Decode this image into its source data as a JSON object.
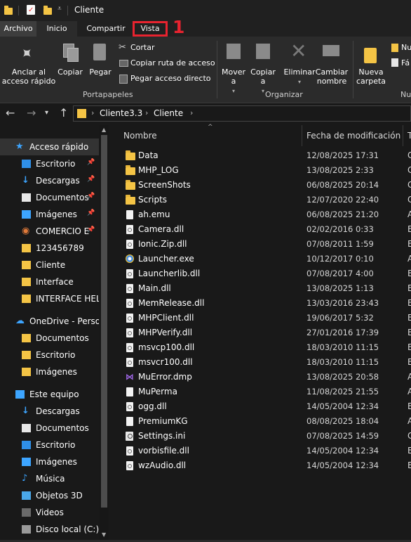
{
  "window": {
    "title": "Cliente"
  },
  "tabs": {
    "file": "Archivo",
    "home": "Inicio",
    "share": "Compartir",
    "view": "Vista"
  },
  "annotation": {
    "step_number": "1",
    "highlight_color": "#e8232f"
  },
  "ribbon": {
    "pin_label": "Anclar al acceso rápido",
    "copy_label": "Copiar",
    "paste_label": "Pegar",
    "cut_label": "Cortar",
    "copy_path_label": "Copiar ruta de acceso",
    "paste_shortcut_label": "Pegar acceso directo",
    "clipboard_group": "Portapapeles",
    "move_to_label": "Mover a",
    "copy_to_label": "Copiar a",
    "delete_label": "Eliminar",
    "rename_label": "Cambiar nombre",
    "organize_group": "Organizar",
    "new_folder_label": "Nueva carpeta",
    "new_item_label": "Nu",
    "easy_access_label": "Fá",
    "new_group": "Nu"
  },
  "address": {
    "crumb1": "Cliente3.3",
    "crumb2": "Cliente"
  },
  "columns": {
    "name": "Nombre",
    "date": "Fecha de modificación",
    "type": "T"
  },
  "sidebar": {
    "items": [
      {
        "label": "Acceso rápido",
        "icon": "star-icon",
        "pinned": false
      },
      {
        "label": "Escritorio",
        "icon": "desktop-icon",
        "pinned": true
      },
      {
        "label": "Descargas",
        "icon": "download-icon",
        "pinned": true
      },
      {
        "label": "Documentos",
        "icon": "document-icon",
        "pinned": true
      },
      {
        "label": "Imágenes",
        "icon": "pictures-icon",
        "pinned": true
      },
      {
        "label": "COMERCIO E",
        "icon": "shortcut-icon",
        "pinned": true
      },
      {
        "label": "123456789",
        "icon": "folder-icon",
        "pinned": false
      },
      {
        "label": "Cliente",
        "icon": "folder-icon",
        "pinned": false
      },
      {
        "label": "Interface",
        "icon": "folder-icon",
        "pinned": false
      },
      {
        "label": "INTERFACE HELP",
        "icon": "folder-icon",
        "pinned": false
      },
      {
        "label": "OneDrive - Person",
        "icon": "cloud-icon",
        "pinned": false
      },
      {
        "label": "Documentos",
        "icon": "folder-icon",
        "pinned": false
      },
      {
        "label": "Escritorio",
        "icon": "folder-icon",
        "pinned": false
      },
      {
        "label": "Imágenes",
        "icon": "folder-icon",
        "pinned": false
      },
      {
        "label": "Este equipo",
        "icon": "computer-icon",
        "pinned": false
      },
      {
        "label": "Descargas",
        "icon": "download-icon",
        "pinned": false
      },
      {
        "label": "Documentos",
        "icon": "document-icon",
        "pinned": false
      },
      {
        "label": "Escritorio",
        "icon": "desktop-icon",
        "pinned": false
      },
      {
        "label": "Imágenes",
        "icon": "pictures-icon",
        "pinned": false
      },
      {
        "label": "Música",
        "icon": "music-icon",
        "pinned": false
      },
      {
        "label": "Objetos 3D",
        "icon": "cube-icon",
        "pinned": false
      },
      {
        "label": "Videos",
        "icon": "video-icon",
        "pinned": false
      },
      {
        "label": "Disco local (C:)",
        "icon": "drive-icon",
        "pinned": false
      }
    ]
  },
  "files": [
    {
      "name": "Data",
      "date": "12/08/2025 17:31",
      "type": "C",
      "icon": "folder-icon"
    },
    {
      "name": "MHP_LOG",
      "date": "13/08/2025 2:33",
      "type": "C",
      "icon": "folder-icon"
    },
    {
      "name": "ScreenShots",
      "date": "06/08/2025 20:14",
      "type": "C",
      "icon": "folder-icon"
    },
    {
      "name": "Scripts",
      "date": "12/07/2020 22:40",
      "type": "C",
      "icon": "folder-icon"
    },
    {
      "name": "ah.emu",
      "date": "06/08/2025 21:20",
      "type": "A",
      "icon": "file-icon"
    },
    {
      "name": "Camera.dll",
      "date": "02/02/2016 0:33",
      "type": "E",
      "icon": "dll-icon"
    },
    {
      "name": "Ionic.Zip.dll",
      "date": "07/08/2011 1:59",
      "type": "E",
      "icon": "dll-icon"
    },
    {
      "name": "Launcher.exe",
      "date": "10/12/2017 0:10",
      "type": "A",
      "icon": "gear-icon"
    },
    {
      "name": "Launcherlib.dll",
      "date": "07/08/2017 4:00",
      "type": "E",
      "icon": "dll-icon"
    },
    {
      "name": "Main.dll",
      "date": "13/08/2025 1:13",
      "type": "E",
      "icon": "dll-icon"
    },
    {
      "name": "MemRelease.dll",
      "date": "13/03/2016 23:43",
      "type": "E",
      "icon": "dll-icon"
    },
    {
      "name": "MHPClient.dll",
      "date": "19/06/2017 5:32",
      "type": "E",
      "icon": "dll-icon"
    },
    {
      "name": "MHPVerify.dll",
      "date": "27/01/2016 17:39",
      "type": "E",
      "icon": "dll-icon"
    },
    {
      "name": "msvcp100.dll",
      "date": "18/03/2010 11:15",
      "type": "E",
      "icon": "dll-icon"
    },
    {
      "name": "msvcr100.dll",
      "date": "18/03/2010 11:15",
      "type": "E",
      "icon": "dll-icon"
    },
    {
      "name": "MuError.dmp",
      "date": "13/08/2025 20:58",
      "type": "A",
      "icon": "visual-studio-icon"
    },
    {
      "name": "MuPerma",
      "date": "11/08/2025 21:55",
      "type": "A",
      "icon": "file-icon"
    },
    {
      "name": "ogg.dll",
      "date": "14/05/2004 12:34",
      "type": "E",
      "icon": "dll-icon"
    },
    {
      "name": "PremiumKG",
      "date": "08/08/2025 18:04",
      "type": "A",
      "icon": "file-icon"
    },
    {
      "name": "Settings.ini",
      "date": "07/08/2025 14:59",
      "type": "C",
      "icon": "ini-icon"
    },
    {
      "name": "vorbisfile.dll",
      "date": "14/05/2004 12:34",
      "type": "E",
      "icon": "dll-icon"
    },
    {
      "name": "wzAudio.dll",
      "date": "14/05/2004 12:34",
      "type": "E",
      "icon": "dll-icon"
    }
  ]
}
